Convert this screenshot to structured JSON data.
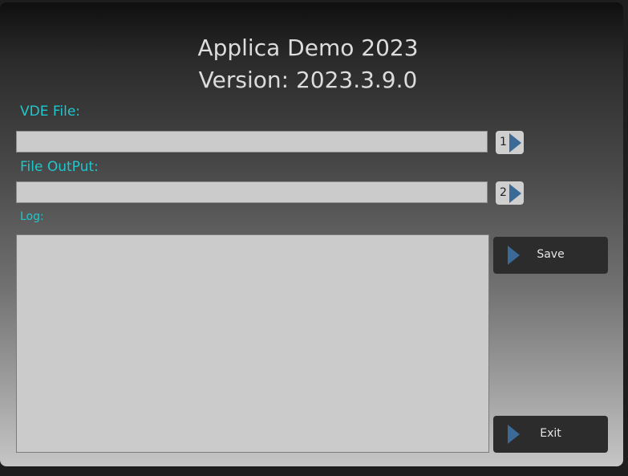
{
  "app": {
    "title": "Applica Demo 2023",
    "version": "Version: 2023.3.9.0"
  },
  "vde_file": {
    "label": "VDE File:",
    "value": "",
    "button_number": "1",
    "button_icon": "play-triangle-icon"
  },
  "file_output": {
    "label": "File OutPut:",
    "value": "",
    "button_number": "2",
    "button_icon": "play-triangle-icon"
  },
  "log": {
    "label": "Log:",
    "value": ""
  },
  "actions": {
    "save_label": "Save",
    "exit_label": "Exit"
  },
  "colors": {
    "label_accent": "#1fc7cc",
    "triangle_blue": "#3a6a95",
    "button_dark": "#2c2c2c"
  }
}
